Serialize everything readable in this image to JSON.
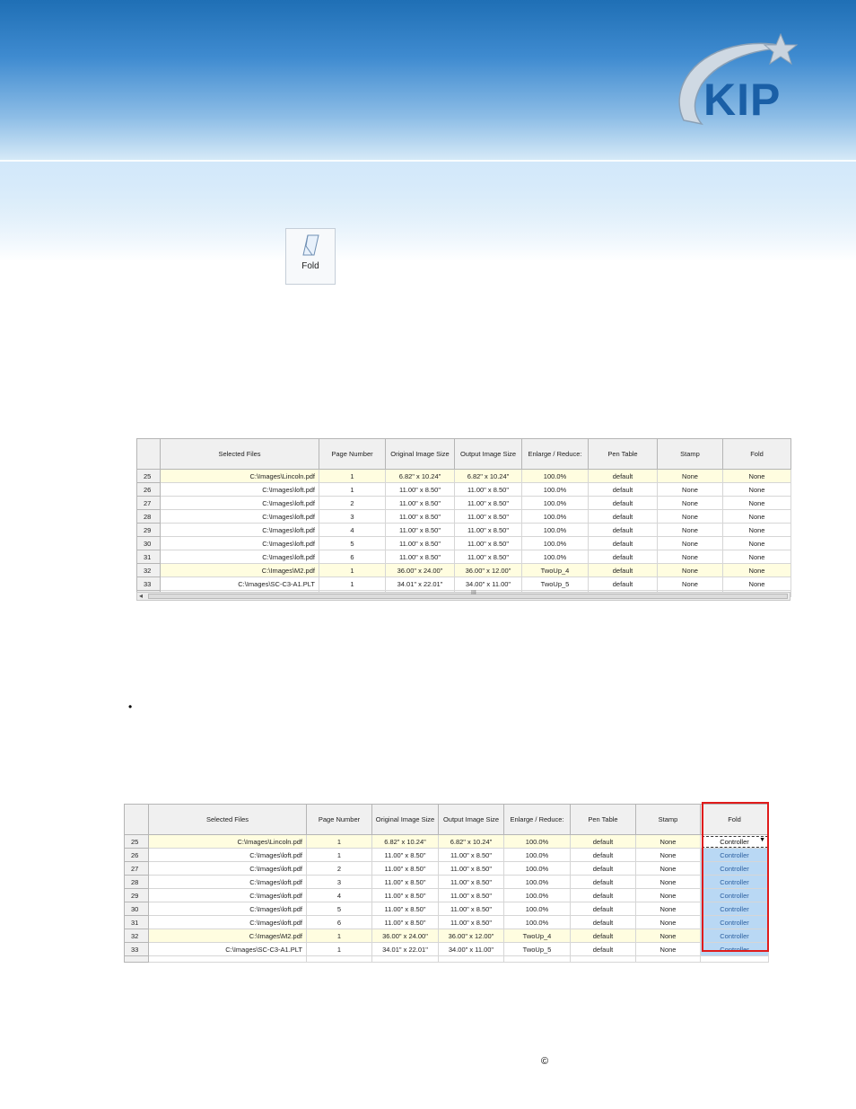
{
  "brand": {
    "logo_text": "KIP"
  },
  "fold_button": {
    "label": "Fold",
    "icon": "fold-icon"
  },
  "grid_headers": [
    "Selected Files",
    "Page Number",
    "Original Image Size",
    "Output Image Size",
    "Enlarge / Reduce:",
    "Pen Table",
    "Stamp",
    "Fold"
  ],
  "grid1": {
    "rows": [
      {
        "n": "25",
        "file": "C:\\Images\\Lincoln.pdf",
        "page": "1",
        "orig": "6.82\" x 10.24\"",
        "out": "6.82\" x 10.24\"",
        "scale": "100.0%",
        "pen": "default",
        "stamp": "None",
        "fold": "None",
        "hl": true
      },
      {
        "n": "26",
        "file": "C:\\Images\\loft.pdf",
        "page": "1",
        "orig": "11.00\" x 8.50\"",
        "out": "11.00\" x 8.50\"",
        "scale": "100.0%",
        "pen": "default",
        "stamp": "None",
        "fold": "None",
        "hl": false
      },
      {
        "n": "27",
        "file": "C:\\Images\\loft.pdf",
        "page": "2",
        "orig": "11.00\" x 8.50\"",
        "out": "11.00\" x 8.50\"",
        "scale": "100.0%",
        "pen": "default",
        "stamp": "None",
        "fold": "None",
        "hl": false
      },
      {
        "n": "28",
        "file": "C:\\Images\\loft.pdf",
        "page": "3",
        "orig": "11.00\" x 8.50\"",
        "out": "11.00\" x 8.50\"",
        "scale": "100.0%",
        "pen": "default",
        "stamp": "None",
        "fold": "None",
        "hl": false
      },
      {
        "n": "29",
        "file": "C:\\Images\\loft.pdf",
        "page": "4",
        "orig": "11.00\" x 8.50\"",
        "out": "11.00\" x 8.50\"",
        "scale": "100.0%",
        "pen": "default",
        "stamp": "None",
        "fold": "None",
        "hl": false
      },
      {
        "n": "30",
        "file": "C:\\Images\\loft.pdf",
        "page": "5",
        "orig": "11.00\" x 8.50\"",
        "out": "11.00\" x 8.50\"",
        "scale": "100.0%",
        "pen": "default",
        "stamp": "None",
        "fold": "None",
        "hl": false
      },
      {
        "n": "31",
        "file": "C:\\Images\\loft.pdf",
        "page": "6",
        "orig": "11.00\" x 8.50\"",
        "out": "11.00\" x 8.50\"",
        "scale": "100.0%",
        "pen": "default",
        "stamp": "None",
        "fold": "None",
        "hl": false
      },
      {
        "n": "32",
        "file": "C:\\Images\\M2.pdf",
        "page": "1",
        "orig": "36.00\" x 24.00\"",
        "out": "36.00\" x 12.00\"",
        "scale": "TwoUp_4",
        "pen": "default",
        "stamp": "None",
        "fold": "None",
        "hl": true
      },
      {
        "n": "33",
        "file": "C:\\Images\\SC-C3-A1.PLT",
        "page": "1",
        "orig": "34.01\" x 22.01\"",
        "out": "34.00\" x 11.00\"",
        "scale": "TwoUp_5",
        "pen": "default",
        "stamp": "None",
        "fold": "None",
        "hl": false
      }
    ],
    "scroll_grip": "III"
  },
  "grid2": {
    "rows": [
      {
        "n": "25",
        "file": "C:\\Images\\Lincoln.pdf",
        "page": "1",
        "orig": "6.82\" x 10.24\"",
        "out": "6.82\" x 10.24\"",
        "scale": "100.0%",
        "pen": "default",
        "stamp": "None",
        "fold": "Controller",
        "hl": true
      },
      {
        "n": "26",
        "file": "C:\\Images\\loft.pdf",
        "page": "1",
        "orig": "11.00\" x 8.50\"",
        "out": "11.00\" x 8.50\"",
        "scale": "100.0%",
        "pen": "default",
        "stamp": "None",
        "fold": "Controller",
        "hl": false
      },
      {
        "n": "27",
        "file": "C:\\Images\\loft.pdf",
        "page": "2",
        "orig": "11.00\" x 8.50\"",
        "out": "11.00\" x 8.50\"",
        "scale": "100.0%",
        "pen": "default",
        "stamp": "None",
        "fold": "Controller",
        "hl": false
      },
      {
        "n": "28",
        "file": "C:\\Images\\loft.pdf",
        "page": "3",
        "orig": "11.00\" x 8.50\"",
        "out": "11.00\" x 8.50\"",
        "scale": "100.0%",
        "pen": "default",
        "stamp": "None",
        "fold": "Controller",
        "hl": false
      },
      {
        "n": "29",
        "file": "C:\\Images\\loft.pdf",
        "page": "4",
        "orig": "11.00\" x 8.50\"",
        "out": "11.00\" x 8.50\"",
        "scale": "100.0%",
        "pen": "default",
        "stamp": "None",
        "fold": "Controller",
        "hl": false
      },
      {
        "n": "30",
        "file": "C:\\Images\\loft.pdf",
        "page": "5",
        "orig": "11.00\" x 8.50\"",
        "out": "11.00\" x 8.50\"",
        "scale": "100.0%",
        "pen": "default",
        "stamp": "None",
        "fold": "Controller",
        "hl": false
      },
      {
        "n": "31",
        "file": "C:\\Images\\loft.pdf",
        "page": "6",
        "orig": "11.00\" x 8.50\"",
        "out": "11.00\" x 8.50\"",
        "scale": "100.0%",
        "pen": "default",
        "stamp": "None",
        "fold": "Controller",
        "hl": false
      },
      {
        "n": "32",
        "file": "C:\\Images\\M2.pdf",
        "page": "1",
        "orig": "36.00\" x 24.00\"",
        "out": "36.00\" x 12.00\"",
        "scale": "TwoUp_4",
        "pen": "default",
        "stamp": "None",
        "fold": "Controller",
        "hl": true
      },
      {
        "n": "33",
        "file": "C:\\Images\\SC-C3-A1.PLT",
        "page": "1",
        "orig": "34.01\" x 22.01\"",
        "out": "34.00\" x 11.00\"",
        "scale": "TwoUp_5",
        "pen": "default",
        "stamp": "None",
        "fold": "Controller",
        "hl": false
      }
    ]
  },
  "bullet": "•",
  "copyright": "©",
  "colors": {
    "highlight_row": "#fffde0",
    "fold_selected": "#b9d8f4",
    "red_outline": "#e01b1b",
    "banner_blue": "#1f6fb5"
  }
}
